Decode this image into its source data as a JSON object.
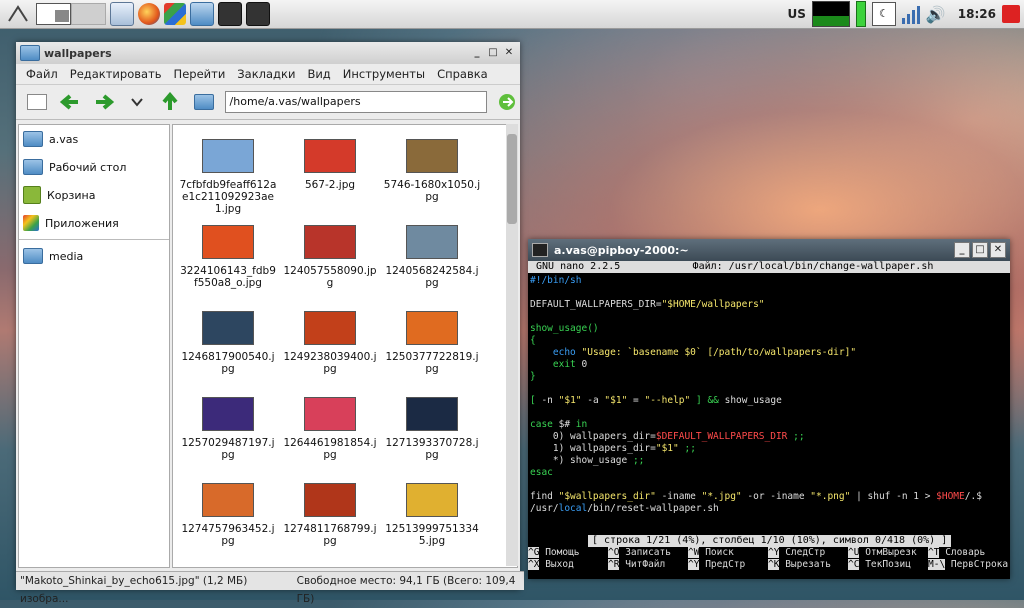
{
  "panel": {
    "clock": "18:26",
    "layout": "US"
  },
  "file_manager": {
    "title": "wallpapers",
    "menu": [
      "Файл",
      "Редактировать",
      "Перейти",
      "Закладки",
      "Вид",
      "Инструменты",
      "Справка"
    ],
    "path": "/home/a.vas/wallpapers",
    "places": [
      "a.vas",
      "Рабочий стол",
      "Корзина",
      "Приложения"
    ],
    "devices": [
      "media"
    ],
    "files": [
      {
        "name": "7cfbfdb9feaff612ae1c211092923ae1.jpg",
        "color": "#7aa6d6"
      },
      {
        "name": "567-2.jpg",
        "color": "#d43a2a"
      },
      {
        "name": "5746-1680x1050.jpg",
        "color": "#8a6a3a"
      },
      {
        "name": "3224106143_fdb9f550a8_o.jpg",
        "color": "#e0501f"
      },
      {
        "name": "124057558090.jpg",
        "color": "#b8342a"
      },
      {
        "name": "1240568242584.jpg",
        "color": "#6f8aa0"
      },
      {
        "name": "1246817900540.jpg",
        "color": "#2d4660"
      },
      {
        "name": "1249238039400.jpg",
        "color": "#c2401a"
      },
      {
        "name": "1250377722819.jpg",
        "color": "#e06b20"
      },
      {
        "name": "1257029487197.jpg",
        "color": "#3c2a7a"
      },
      {
        "name": "1264461981854.jpg",
        "color": "#d8405a"
      },
      {
        "name": "1271393370728.jpg",
        "color": "#1b2a44"
      },
      {
        "name": "1274757963452.jpg",
        "color": "#d86a2a"
      },
      {
        "name": "1274811768799.jpg",
        "color": "#b0361a"
      },
      {
        "name": "125139997513345.jpg",
        "color": "#e0b030"
      }
    ],
    "status_selected": "\"Makoto_Shinkai_by_echo615.jpg\" (1,2 МБ) изобра...",
    "status_free": "Свободное место: 94,1 ГБ (Всего: 109,4 ГБ)"
  },
  "terminal": {
    "title": "a.vas@pipboy-2000:~",
    "nano_version": "GNU nano 2.2.5",
    "file_label": "Файл: /usr/local/bin/change-wallpaper.sh",
    "status": "[ строка 1/21 (4%), столбец 1/10 (10%), символ 0/418 (0%) ]",
    "shortcuts_row1": [
      {
        "k": "^G",
        "l": "Помощь"
      },
      {
        "k": "^O",
        "l": "Записать"
      },
      {
        "k": "^W",
        "l": "Поиск"
      },
      {
        "k": "^Y",
        "l": "СледСтр"
      },
      {
        "k": "^U",
        "l": "ОтмВырезк"
      },
      {
        "k": "^T",
        "l": "Словарь"
      }
    ],
    "shortcuts_row2": [
      {
        "k": "^X",
        "l": "Выход"
      },
      {
        "k": "^R",
        "l": "ЧитФайл"
      },
      {
        "k": "^Y",
        "l": "ПредСтр"
      },
      {
        "k": "^K",
        "l": "Вырезать"
      },
      {
        "k": "^C",
        "l": "ТекПозиц"
      },
      {
        "k": "M-\\",
        "l": "ПервСтрока"
      }
    ]
  }
}
